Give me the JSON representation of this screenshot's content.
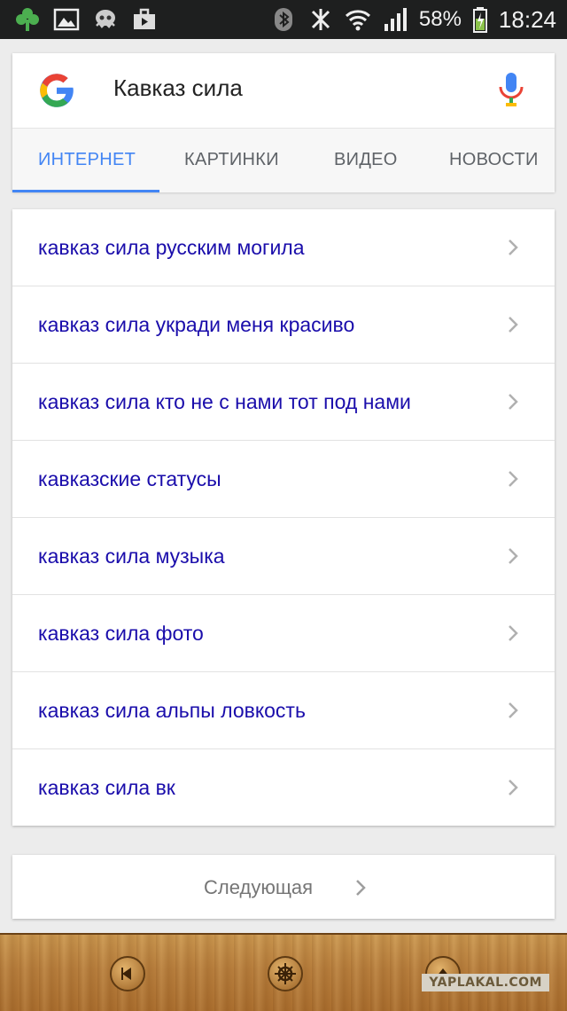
{
  "status_bar": {
    "battery_percent": "58%",
    "time": "18:24",
    "icons": [
      "clover-icon",
      "image-icon",
      "octopus-icon",
      "briefcase-icon",
      "bluetooth-icon",
      "nfc-icon",
      "wifi-icon",
      "signal-icon",
      "battery-charging-icon"
    ]
  },
  "search": {
    "query": "Кавказ сила",
    "tabs": [
      {
        "label": "ИНТЕРНЕТ",
        "active": true
      },
      {
        "label": "КАРТИНКИ",
        "active": false
      },
      {
        "label": "ВИДЕО",
        "active": false
      },
      {
        "label": "НОВОСТИ",
        "active": false
      }
    ]
  },
  "suggestions": [
    "кавказ сила русским могила",
    "кавказ сила укради меня красиво",
    "кавказ сила кто не с нами тот под нами",
    "кавказские статусы",
    "кавказ сила музыка",
    "кавказ сила фото",
    "кавказ сила альпы ловкость",
    "кавказ сила вк"
  ],
  "next_label": "Следующая",
  "watermark": "YAPLAKAL.COM",
  "colors": {
    "link": "#1a0dab",
    "accent": "#4285f4",
    "statusbar_bg": "#1e1f1f"
  }
}
